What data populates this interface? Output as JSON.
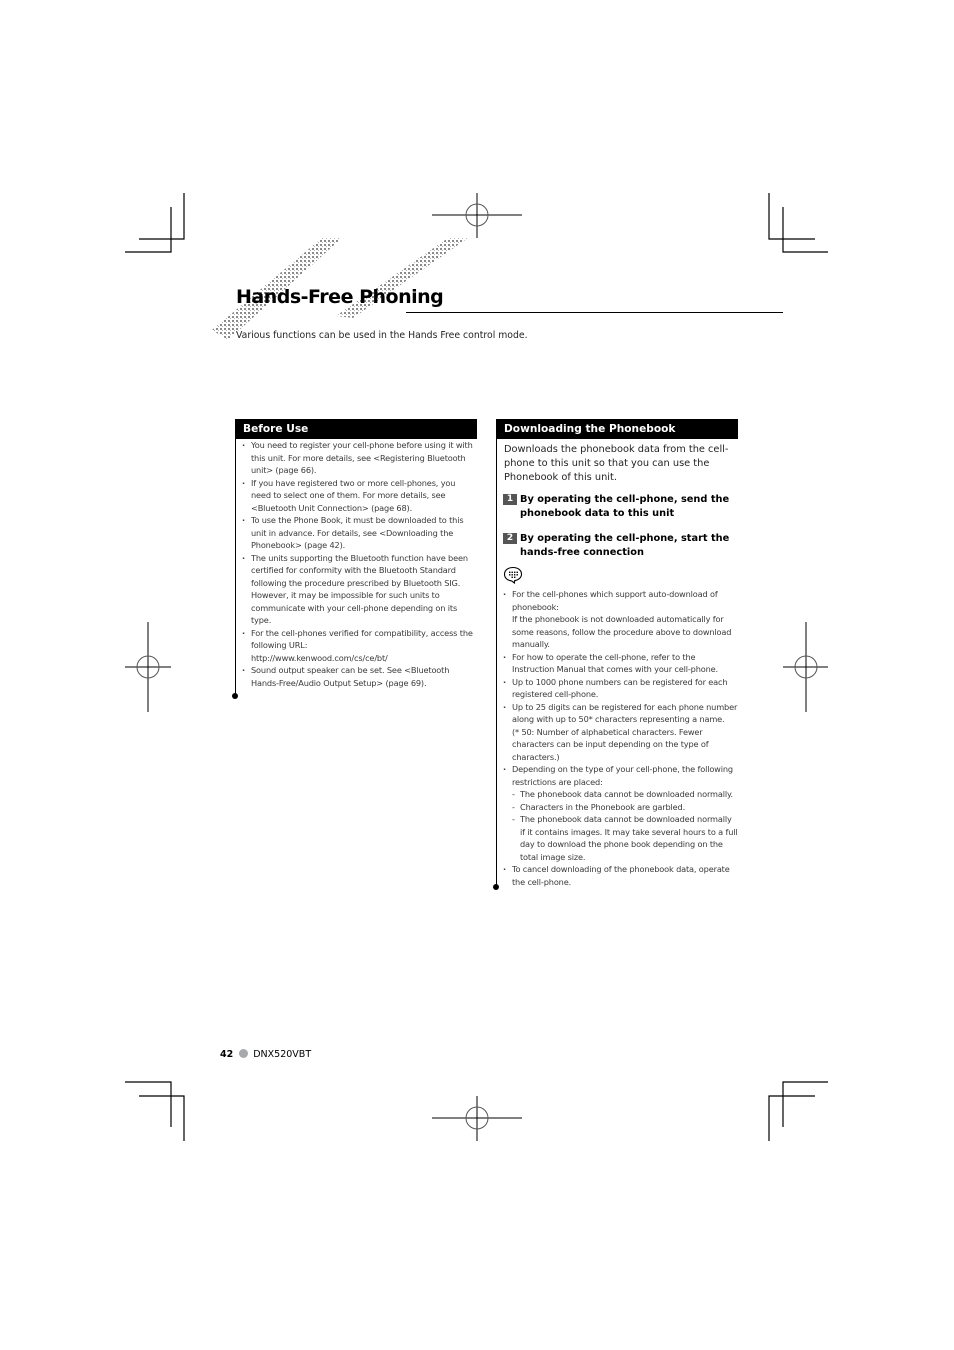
{
  "page": {
    "title": "Hands-Free Phoning",
    "intro": "Various functions can be used in the Hands Free control mode.",
    "footer": {
      "page_number": "42",
      "model": "DNX520VBT"
    }
  },
  "before_use": {
    "heading": "Before Use",
    "bullets": [
      "You need to register your cell-phone before using it with this unit. For more details, see <Registering Bluetooth unit> (page 66).",
      "If you have registered two or more cell-phones, you need to select one of them. For more details, see <Bluetooth Unit Connection> (page 68).",
      "To use the Phone Book, it must be downloaded to this unit in advance. For details, see <Downloading the Phonebook> (page 42).",
      "The units supporting the Bluetooth function have been certified for conformity with the Bluetooth Standard following the procedure prescribed by Bluetooth SIG. However, it may be impossible for such units to communicate with your cell-phone depending on its type.",
      "For the cell-phones verified for compatibility, access the following URL:",
      "Sound output speaker can be set. See <Bluetooth Hands-Free/Audio Output Setup> (page 69)."
    ],
    "url": "http://www.kenwood.com/cs/ce/bt/"
  },
  "downloading": {
    "heading": "Downloading the Phonebook",
    "description": "Downloads the phonebook data from the cell-phone to this unit so that you can use the Phonebook of this unit.",
    "steps": [
      {
        "number": "1",
        "text": "By operating the cell-phone, send the phonebook data to this unit"
      },
      {
        "number": "2",
        "text": "By operating the cell-phone, start the hands-free connection"
      }
    ],
    "note_icon": "note-speech-bubble-icon",
    "notes": [
      {
        "text": "For the cell-phones which support auto-download of phonebook:",
        "extra": "If the phonebook is not downloaded automatically for some reasons, follow the procedure above to download manually."
      },
      {
        "text": "For how to operate the cell-phone, refer to the Instruction Manual that comes with your cell-phone."
      },
      {
        "text": "Up to 1000 phone numbers can be registered for each registered cell-phone."
      },
      {
        "text": "Up to 25 digits can be registered for each phone number along with up to 50* characters representing a name.",
        "extra": "(* 50: Number of alphabetical characters. Fewer characters can be input depending on the type of characters.)"
      },
      {
        "text": "Depending on the type of your cell-phone, the following restrictions are placed:",
        "sub": [
          "The phonebook data cannot be downloaded normally.",
          "Characters in the Phonebook are garbled.",
          "The phonebook data cannot be downloaded normally if it contains images. It may take several hours to a full day to download the phone book depending on the total image size."
        ]
      },
      {
        "text": "To cancel downloading of the phonebook data, operate the cell-phone."
      }
    ]
  }
}
